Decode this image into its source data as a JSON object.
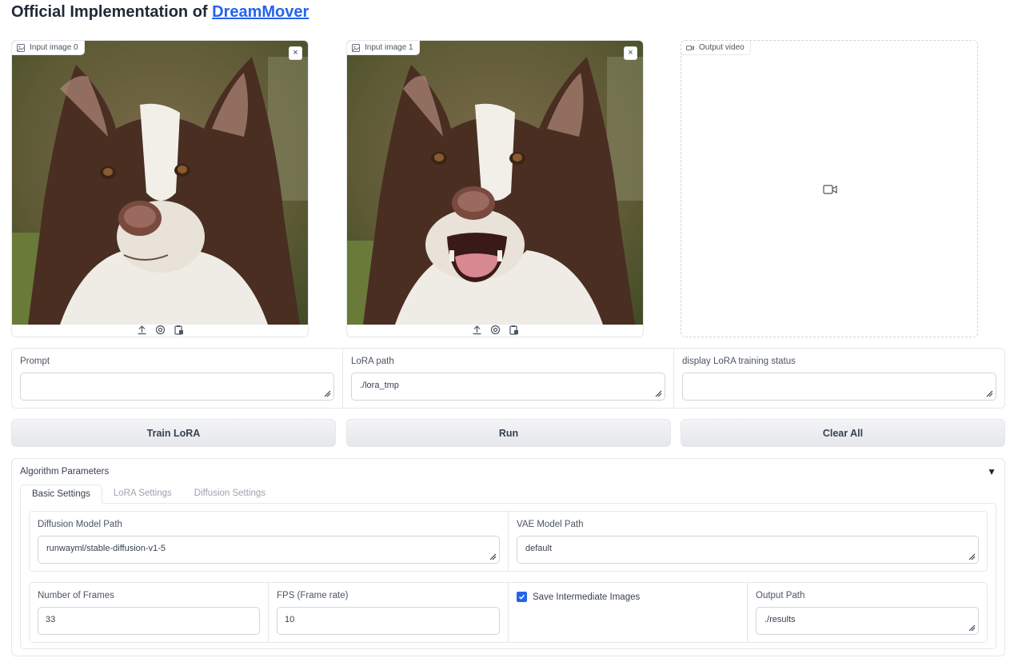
{
  "header": {
    "title_prefix": "Official Implementation of ",
    "title_link": "DreamMover"
  },
  "panels": {
    "input0": {
      "label": "Input image 0",
      "close": "×"
    },
    "input1": {
      "label": "Input image 1",
      "close": "×"
    },
    "output": {
      "label": "Output video"
    }
  },
  "fields": {
    "prompt": {
      "label": "Prompt",
      "value": ""
    },
    "lora_path": {
      "label": "LoRA path",
      "value": "./lora_tmp"
    },
    "lora_status": {
      "label": "display LoRA training status",
      "value": ""
    }
  },
  "buttons": {
    "train": "Train LoRA",
    "run": "Run",
    "clear": "Clear All"
  },
  "accordion": {
    "title": "Algorithm Parameters",
    "arrow": "▼",
    "tabs": [
      "Basic Settings",
      "LoRA Settings",
      "Diffusion Settings"
    ],
    "basic": {
      "diffusion_model_path": {
        "label": "Diffusion Model Path",
        "value": "runwayml/stable-diffusion-v1-5"
      },
      "vae_model_path": {
        "label": "VAE Model Path",
        "value": "default"
      },
      "num_frames": {
        "label": "Number of Frames",
        "value": "33"
      },
      "fps": {
        "label": "FPS (Frame rate)",
        "value": "10"
      },
      "save_intermediate": {
        "label": "Save Intermediate Images",
        "checked": true
      },
      "output_path": {
        "label": "Output Path",
        "value": "./results"
      }
    }
  },
  "colors": {
    "accent": "#2563eb",
    "link": "#2563eb"
  }
}
